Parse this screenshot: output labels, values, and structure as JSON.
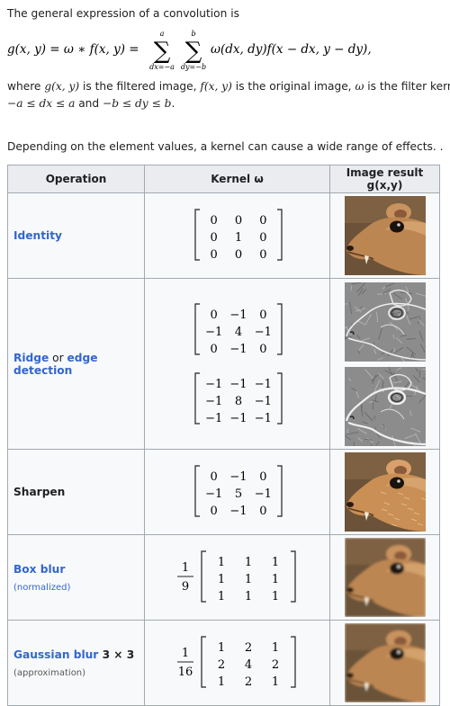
{
  "intro": "The general expression of a convolution is",
  "formula": {
    "lhs": "g(x, y) = ω ∗ f(x, y) =",
    "sum1_top": "a",
    "sum1_bottom": "dx=−a",
    "sum2_top": "b",
    "sum2_bottom": "dy=−b",
    "term": "ω(dx, dy)f(x − dx, y − dy),"
  },
  "where_line1": {
    "t1": "where ",
    "m1": "g(x, y)",
    "t2": " is the filtered image, ",
    "m2": "f(x, y)",
    "t3": " is the original image, ",
    "m3": "ω",
    "t4": " is the filter kernel"
  },
  "where_line2": {
    "m1": "−a ≤ dx ≤ a",
    "t1": " and ",
    "m2": "−b ≤ dy ≤ b",
    "t2": "."
  },
  "lead_text": "Depending on the element values, a kernel can cause a wide range of effects. .",
  "table": {
    "headers": [
      "Operation",
      "Kernel ω",
      "Image result g(x,y)"
    ],
    "rows": [
      {
        "label": "Identity",
        "note": "",
        "kernels": [
          {
            "prefix_num": "",
            "prefix_den": "",
            "m": [
              [
                "0",
                "0",
                "0"
              ],
              [
                "0",
                "1",
                "0"
              ],
              [
                "0",
                "0",
                "0"
              ]
            ]
          }
        ],
        "result": "identity"
      },
      {
        "label": "Ridge",
        "label_mid": " or ",
        "label2": "edge detection",
        "note": "",
        "kernels": [
          {
            "prefix_num": "",
            "prefix_den": "",
            "m": [
              [
                "0",
                "−1",
                "0"
              ],
              [
                "−1",
                "4",
                "−1"
              ],
              [
                "0",
                "−1",
                "0"
              ]
            ]
          },
          {
            "prefix_num": "",
            "prefix_den": "",
            "m": [
              [
                "−1",
                "−1",
                "−1"
              ],
              [
                "−1",
                "8",
                "−1"
              ],
              [
                "−1",
                "−1",
                "−1"
              ]
            ]
          }
        ],
        "result": "edge"
      },
      {
        "label": "Sharpen",
        "note": "",
        "kernels": [
          {
            "prefix_num": "",
            "prefix_den": "",
            "m": [
              [
                "0",
                "−1",
                "0"
              ],
              [
                "−1",
                "5",
                "−1"
              ],
              [
                "0",
                "−1",
                "0"
              ]
            ]
          }
        ],
        "result": "sharpen"
      },
      {
        "label": "Box blur",
        "note": "(normalized)",
        "kernels": [
          {
            "prefix_num": "1",
            "prefix_den": "9",
            "m": [
              [
                "1",
                "1",
                "1"
              ],
              [
                "1",
                "1",
                "1"
              ],
              [
                "1",
                "1",
                "1"
              ]
            ]
          }
        ],
        "result": "blur"
      },
      {
        "label": "Gaussian blur",
        "label_suffix": " 3 × 3",
        "note": "(approximation)",
        "kernels": [
          {
            "prefix_num": "1",
            "prefix_den": "16",
            "m": [
              [
                "1",
                "2",
                "1"
              ],
              [
                "2",
                "4",
                "2"
              ],
              [
                "1",
                "2",
                "1"
              ]
            ]
          }
        ],
        "result": "blur"
      }
    ]
  },
  "colors": {
    "link": "#3366cc",
    "header_bg": "#eaecf0",
    "table_bg": "#f8f9fa",
    "border": "#a2a9b1"
  }
}
